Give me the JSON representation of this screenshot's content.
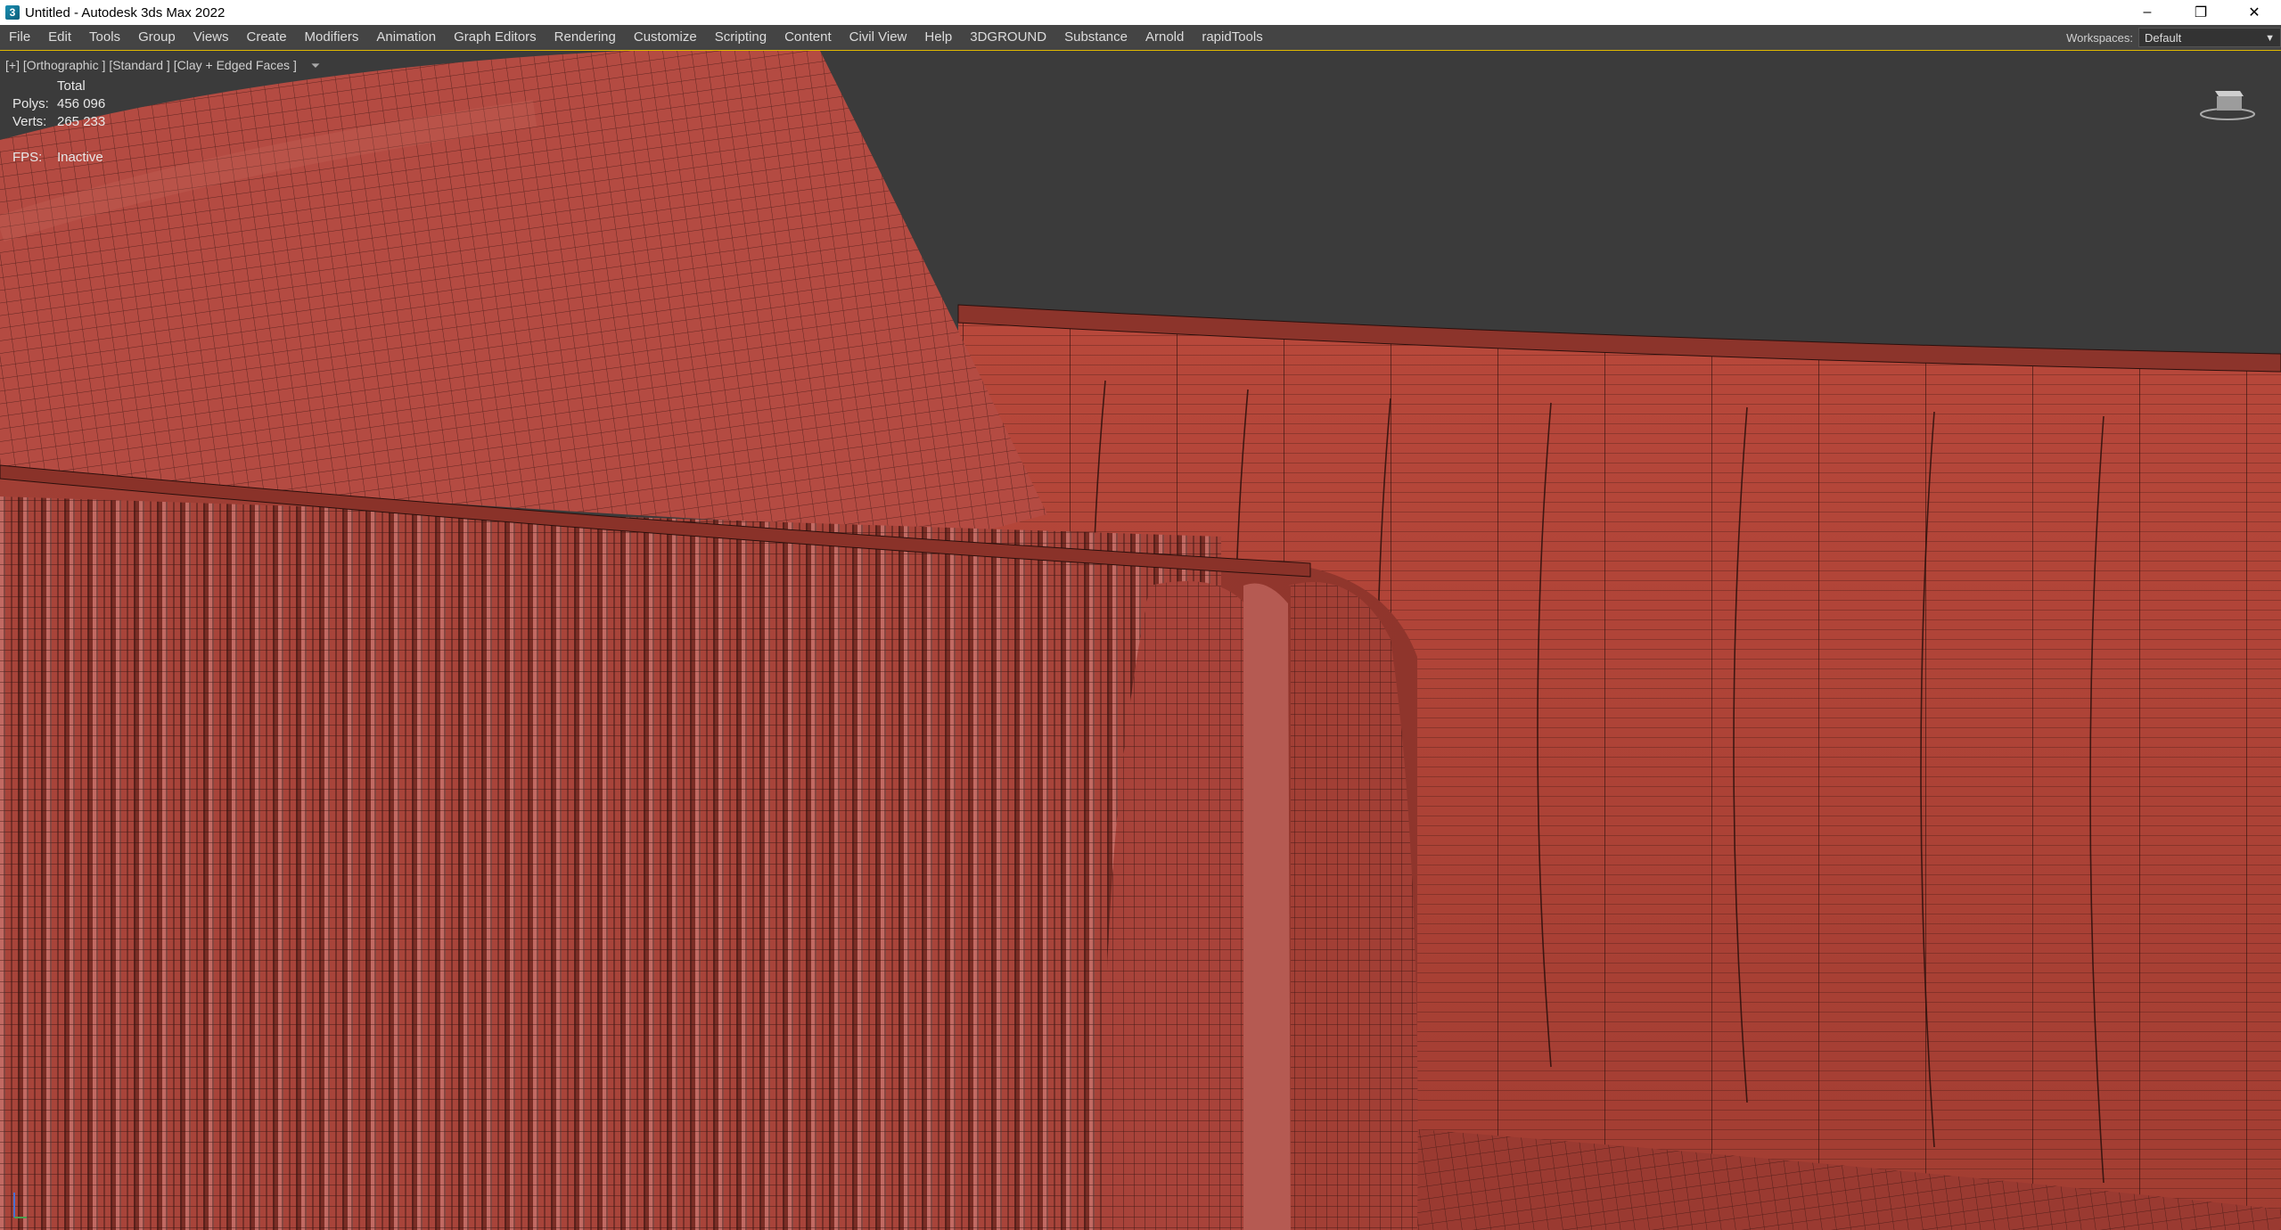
{
  "window": {
    "title": "Untitled - Autodesk 3ds Max 2022",
    "controls": {
      "minimize": "–",
      "restore": "❐",
      "close": "✕"
    }
  },
  "menu": {
    "items": [
      "File",
      "Edit",
      "Tools",
      "Group",
      "Views",
      "Create",
      "Modifiers",
      "Animation",
      "Graph Editors",
      "Rendering",
      "Customize",
      "Scripting",
      "Content",
      "Civil View",
      "Help",
      "3DGROUND",
      "Substance",
      "Arnold",
      "rapidTools"
    ],
    "workspaces_label": "Workspaces:",
    "workspace_value": "Default"
  },
  "viewport": {
    "label": "[+] [Orthographic ] [Standard ] [Clay + Edged Faces ]",
    "stats": {
      "header": "Total",
      "polys_label": "Polys:",
      "polys_value": "456 096",
      "verts_label": "Verts:",
      "verts_value": "265 233",
      "fps_label": "FPS:",
      "fps_value": "Inactive"
    }
  },
  "colors": {
    "clay": "#b5473a",
    "clay_dark": "#8f3a30",
    "wire": "#2a0f0c",
    "background": "#3b3b3b",
    "menu_accent": "#e0b800"
  }
}
